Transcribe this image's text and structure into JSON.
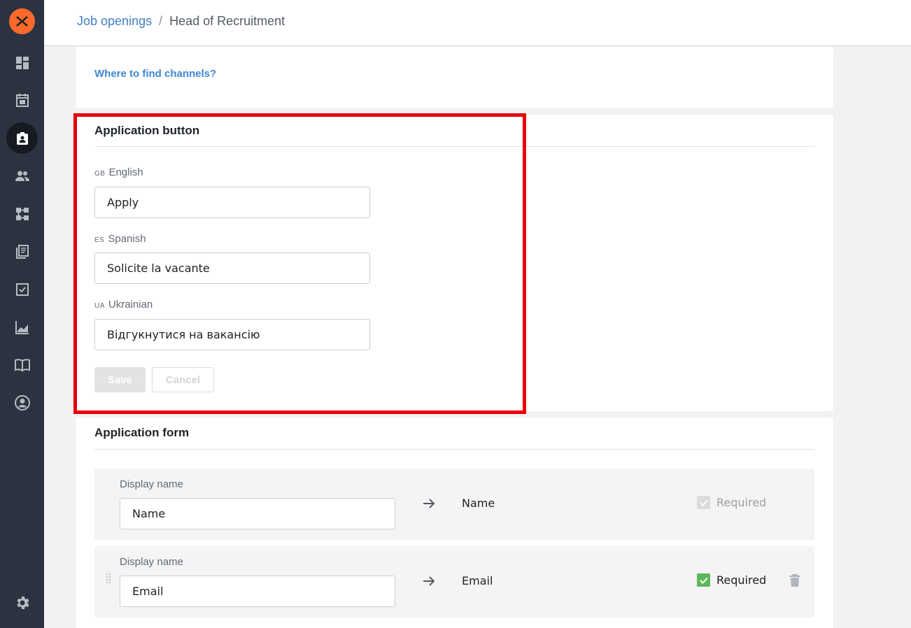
{
  "breadcrumb": {
    "parent": "Job openings",
    "separator": "/",
    "current": "Head of Recruitment"
  },
  "sidebar": {
    "items": [
      {
        "icon": "dashboard-icon"
      },
      {
        "icon": "calendar-icon"
      },
      {
        "icon": "job-openings-icon",
        "active": true
      },
      {
        "icon": "candidates-icon"
      },
      {
        "icon": "pipeline-icon"
      },
      {
        "icon": "library-icon"
      },
      {
        "icon": "tasks-icon"
      },
      {
        "icon": "reports-icon"
      },
      {
        "icon": "knowledge-base-icon"
      },
      {
        "icon": "profile-icon"
      },
      {
        "icon": "settings-icon"
      }
    ],
    "colors": {
      "background": "#2c3340",
      "logo": "#ff6a2b"
    }
  },
  "channels": {
    "help_link": "Where to find channels?"
  },
  "application_button": {
    "title": "Application button",
    "languages": [
      {
        "code": "GB",
        "name": "English",
        "value": "Apply"
      },
      {
        "code": "ES",
        "name": "Spanish",
        "value": "Solicite la vacante"
      },
      {
        "code": "UA",
        "name": "Ukrainian",
        "value": "Відгукнутися на вакансію"
      }
    ],
    "save_label": "Save",
    "cancel_label": "Cancel"
  },
  "application_form": {
    "title": "Application form",
    "fields": [
      {
        "label": "Display name",
        "value": "Name",
        "mapped_to": "Name",
        "required_label": "Required",
        "required": true,
        "required_editable": false,
        "deletable": false
      },
      {
        "label": "Display name",
        "value": "Email",
        "mapped_to": "Email",
        "required_label": "Required",
        "required": true,
        "required_editable": true,
        "deletable": true
      }
    ]
  },
  "accent_colors": {
    "link": "#3f7fc4",
    "highlight_border": "#e8000b",
    "check_green": "#5cb85c"
  }
}
